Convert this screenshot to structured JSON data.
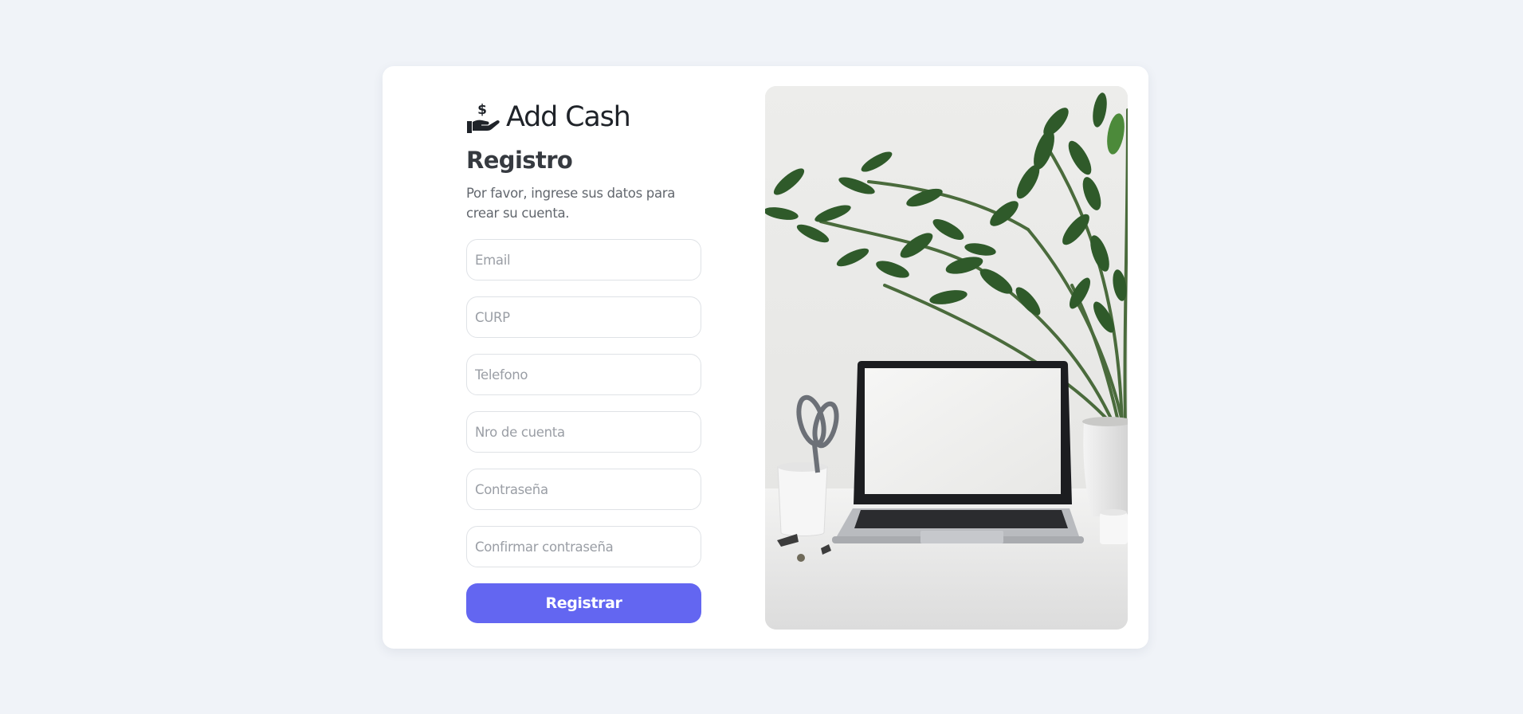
{
  "brand": {
    "name": "Add Cash",
    "icon": "hand-coin-icon"
  },
  "form": {
    "title": "Registro",
    "subtitle": "Por favor, ingrese sus datos para crear su cuenta.",
    "fields": {
      "email": {
        "placeholder": "Email",
        "value": ""
      },
      "curp": {
        "placeholder": "CURP",
        "value": ""
      },
      "telefono": {
        "placeholder": "Telefono",
        "value": ""
      },
      "cuenta": {
        "placeholder": "Nro de cuenta",
        "value": ""
      },
      "password": {
        "placeholder": "Contraseña",
        "value": ""
      },
      "confirm": {
        "placeholder": "Confirmar contraseña",
        "value": ""
      }
    },
    "submit_label": "Registrar"
  },
  "photo": {
    "subject": "laptop-plant-desk-image"
  },
  "colors": {
    "background": "#f0f3f8",
    "card": "#ffffff",
    "accent": "#6366f1",
    "heading": "#363a40",
    "muted": "#62676e"
  }
}
